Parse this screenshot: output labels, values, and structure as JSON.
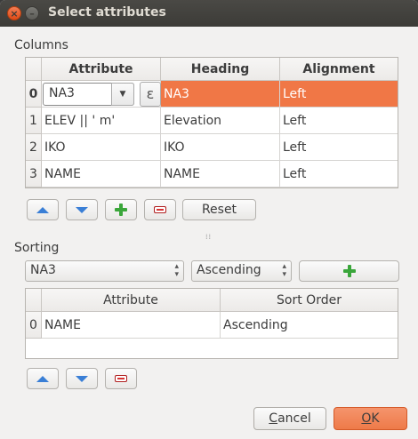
{
  "window": {
    "title": "Select attributes"
  },
  "columns": {
    "label": "Columns",
    "headers": [
      "Attribute",
      "Heading",
      "Alignment"
    ],
    "rows": [
      {
        "num": "0",
        "attribute": "NA3",
        "heading": "NA3",
        "alignment": "Left"
      },
      {
        "num": "1",
        "attribute": "ELEV || ' m'",
        "heading": "Elevation",
        "alignment": "Left"
      },
      {
        "num": "2",
        "attribute": "IKO",
        "heading": "IKO",
        "alignment": "Left"
      },
      {
        "num": "3",
        "attribute": "NAME",
        "heading": "NAME",
        "alignment": "Left"
      }
    ],
    "expression_glyph": "ε",
    "reset_label": "Reset",
    "selected_row_color": "#f07746"
  },
  "sorting": {
    "label": "Sorting",
    "field_value": "NA3",
    "order_value": "Ascending",
    "headers": [
      "Attribute",
      "Sort Order"
    ],
    "rows": [
      {
        "num": "0",
        "attribute": "NAME",
        "order": "Ascending"
      }
    ]
  },
  "buttons": {
    "cancel_pre": "",
    "cancel_u": "C",
    "cancel_post": "ancel",
    "ok_pre": "",
    "ok_u": "O",
    "ok_post": "K"
  },
  "icons": [
    "close-icon",
    "minimize-icon",
    "move-up-icon",
    "move-down-icon",
    "add-icon",
    "remove-icon",
    "expression-icon",
    "chevron-down-icon"
  ]
}
